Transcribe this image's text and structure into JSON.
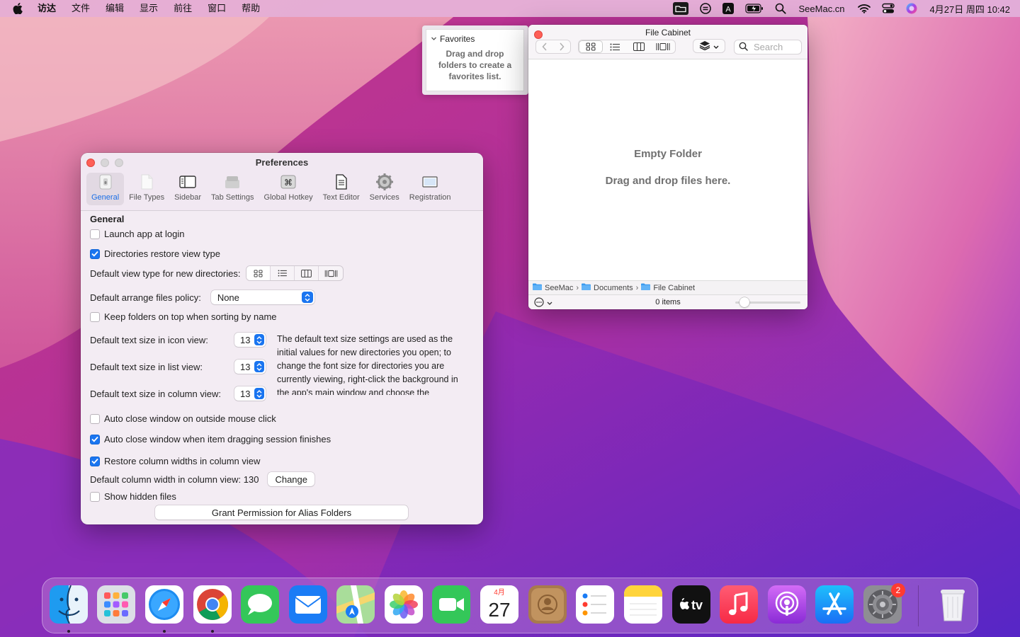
{
  "menubar": {
    "app_name": "访达",
    "items": [
      "文件",
      "编辑",
      "显示",
      "前往",
      "窗口",
      "帮助"
    ],
    "status_text": "SeeMac.cn",
    "clock": "4月27日 周四 10:42"
  },
  "favorites": {
    "header": "Favorites",
    "message": "Drag and drop folders to create a favorites list."
  },
  "cabinet": {
    "title": "File Cabinet",
    "search_placeholder": "Search",
    "empty_title": "Empty Folder",
    "empty_hint": "Drag and drop files here.",
    "path": [
      "SeeMac",
      "Documents",
      "File Cabinet"
    ],
    "item_count": "0 items",
    "icon_size_level": 0.1
  },
  "prefs": {
    "title": "Preferences",
    "tabs": [
      "General",
      "File Types",
      "Sidebar",
      "Tab Settings",
      "Global Hotkey",
      "Text Editor",
      "Services",
      "Registration"
    ],
    "active_tab": "General",
    "section_title": "General",
    "launch_at_login": {
      "label": "Launch app at login",
      "checked": false
    },
    "restore_view_type": {
      "label": "Directories restore view type",
      "checked": true
    },
    "default_view_label": "Default view type for new directories:",
    "arrange_label": "Default arrange files policy:",
    "arrange_value": "None",
    "folders_on_top": {
      "label": "Keep folders on top when sorting by name",
      "checked": false
    },
    "icon_text_label": "Default text size in icon view:",
    "icon_text_value": "13",
    "list_text_label": "Default text size in list view:",
    "list_text_value": "13",
    "column_text_label": "Default text size in column view:",
    "column_text_value": "13",
    "text_size_note": "The default text size settings are used as the initial values for new directories you open; to change the font size for directories you are currently viewing, right-click the background in the app's main window and choose the",
    "auto_close_outside": {
      "label": "Auto close window on outside mouse click",
      "checked": false
    },
    "auto_close_drag": {
      "label": "Auto close window when item dragging session finishes",
      "checked": true
    },
    "restore_column_widths": {
      "label": "Restore column widths in column view",
      "checked": true
    },
    "column_width_label": "Default column width in column view: 130",
    "change_button": "Change",
    "show_hidden": {
      "label": "Show hidden files",
      "checked": false
    },
    "grant_button": "Grant Permission for Alias Folders"
  },
  "dock": {
    "apps": [
      "Finder",
      "Launchpad",
      "Safari",
      "Chrome",
      "Messages",
      "Mail",
      "Maps",
      "Photos",
      "FaceTime",
      "Calendar",
      "Contacts",
      "Reminders",
      "Notes",
      "TV",
      "Music",
      "Podcasts",
      "App Store",
      "System Preferences",
      "Trash"
    ],
    "calendar_month": "4月",
    "calendar_day": "27",
    "settings_badge": "2",
    "tv_label": "tv"
  },
  "colors": {
    "accent": "#1a75f0",
    "close": "#fe5f57",
    "wallpaper_main": "#b23aa8"
  }
}
